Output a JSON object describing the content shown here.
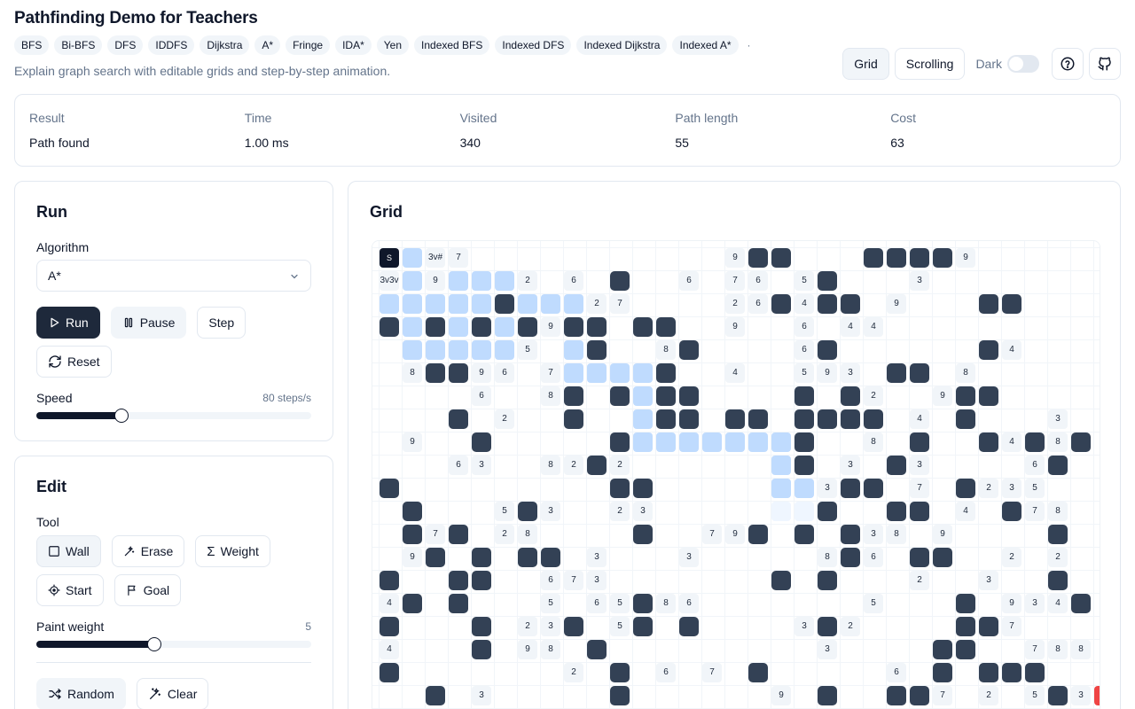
{
  "header": {
    "title": "Pathfinding Demo for Teachers",
    "subtitle": "Explain graph search with editable grids and step-by-step animation.",
    "algorithms": [
      "BFS",
      "Bi-BFS",
      "DFS",
      "IDDFS",
      "Dijkstra",
      "A*",
      "Fringe",
      "IDA*",
      "Yen",
      "Indexed BFS",
      "Indexed DFS",
      "Indexed Dijkstra",
      "Indexed A*"
    ],
    "more_indicator": "·",
    "view_grid": "Grid",
    "view_scrolling": "Scrolling",
    "dark_label": "Dark",
    "dark_enabled": false,
    "help_icon": "help-circle-icon",
    "github_icon": "github-icon"
  },
  "stats": [
    {
      "label": "Result",
      "value": "Path found"
    },
    {
      "label": "Time",
      "value": "1.00 ms"
    },
    {
      "label": "Visited",
      "value": "340"
    },
    {
      "label": "Path length",
      "value": "55"
    },
    {
      "label": "Cost",
      "value": "63"
    }
  ],
  "run": {
    "title": "Run",
    "algorithm_label": "Algorithm",
    "algorithm_value": "A*",
    "run_label": "Run",
    "pause_label": "Pause",
    "step_label": "Step",
    "reset_label": "Reset",
    "speed_label": "Speed",
    "speed_value": "80 steps/s",
    "speed_fraction": 0.31
  },
  "edit": {
    "title": "Edit",
    "tool_label": "Tool",
    "tools": [
      "Wall",
      "Erase",
      "Weight",
      "Start",
      "Goal"
    ],
    "selected_tool": "Wall",
    "paint_weight_label": "Paint weight",
    "paint_weight_value": "5",
    "paint_weight_fraction": 0.43,
    "random_label": "Random",
    "clear_label": "Clear"
  },
  "grid": {
    "title": "Grid",
    "colors": {
      "wall": "#334155",
      "visited": "#bfdbfe",
      "start": "#0f172a",
      "goal": "#ef4444"
    },
    "rows": [
      "S v 3v# 7 . . . . . . . . . . . 9 # # . . . # # # # 9 . . .",
      "3v3v v 9 v v v 2 . 6 . # . . 6 . 7 6 . 5 # . . . 3 . . . .",
      "v v v v v # v v v 2 7 . . . . 2 6 # 4 # # . 9 . . . # # . .",
      "# v # v # v # 9 # # . # # . . 9 . . 6 . 4 4 . . . . . . . .",
      ". v v v v v 5 . v # . . 8 # . . . . 6 # . . . . . . # 4 . .",
      ". 8 # # 9 6 . 7 v v v v # . . 4 . . 5 9 3 . # # . 8 . . . .",
      ". . . . 6 . . 8 # . # v # # . . . . # . # 2 . . 9 # # . . .",
      ". . . # . 2 . . # . . v # # . # # . # # # # . 4 . # . . . 3",
      ". 9 . . # . . . . . # v v v v v v v # . . 8 . # . . # 4 # 8 #",
      ". . . 6 3 . . 8 2 # 2 . . . . . . v # . 3 . # 3 . . . . 6 #",
      "# . . . . . . . . . # # . . . . . v v 3 # # . 7 . # 2 3 5 .",
      ". # . . . 5 # 3 . . 2 3 . . . . . f f # . . # # . 4 . # 7 8",
      ". # 7 # . 2 8 . . . . # . . 7 9 # . # . # 3 8 . 9 . . . . #",
      ". 9 # . # . # # . 3 . . . 3 . . . . . 8 # 6 . # # . . 2 . 2",
      "# . . # # . . 6 7 3 . . . . . . . # . # . . . 2 . . 3 . . #",
      "4 # . # . . . 5 . 6 5 # 8 6 . . . . . . . 5 . . . # . 9 3 4 #",
      "# . . . # . 2 3 # . 5 # . # . . . . 3 # 2 . . . . # # 7 . .",
      "4 . . . # . 9 8 . # . . . . . . . . . 3 . . . . # # . . 7 8 8",
      "# . . . . . . . 2 . # . 6 . 7 . # . . . . . 6 . # . # # # .",
      ". . # . 3 . . . . . # . . . . . . 9 . # . . # # 7 . 2 . 5 # 3 G"
    ]
  }
}
